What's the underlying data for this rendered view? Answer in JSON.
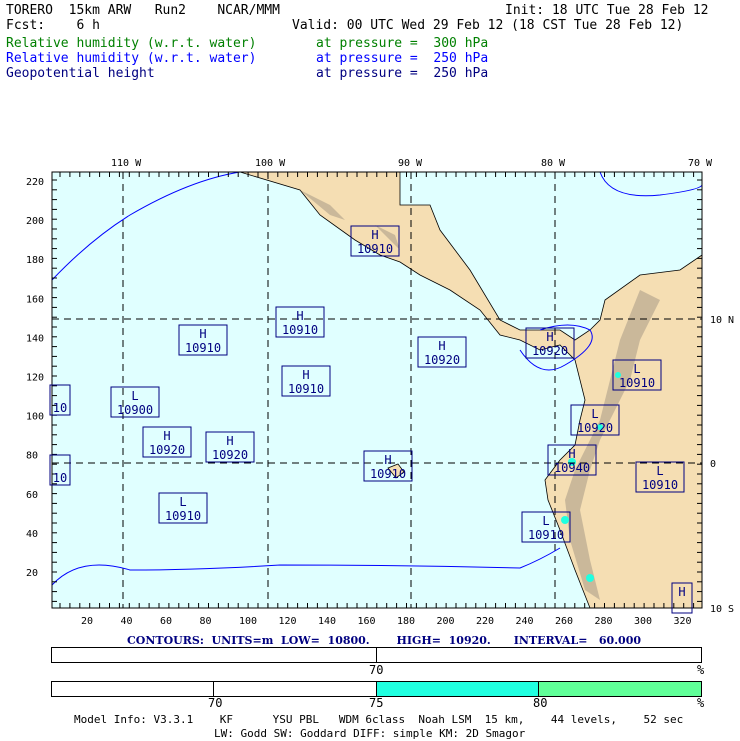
{
  "header": {
    "title": "TORERO  15km ARW   Run2    NCAR/MMM",
    "init": "Init: 18 UTC Tue 28 Feb 12",
    "fcst": "Fcst:    6 h",
    "valid": "Valid: 00 UTC Wed 29 Feb 12 (18 CST Tue 28 Feb 12)",
    "fields": [
      {
        "name": "Relative humidity (w.r.t. water)",
        "level": "at pressure =  300 hPa",
        "color": "#008000"
      },
      {
        "name": "Relative humidity (w.r.t. water)",
        "level": "at pressure =  250 hPa",
        "color": "#0000ff"
      },
      {
        "name": "Geopotential height",
        "level": "at pressure =  250 hPa",
        "color": "#000080"
      }
    ]
  },
  "map": {
    "lon_labels": [
      "110 W",
      "100 W",
      "90 W",
      "80 W",
      "70 W"
    ],
    "lat_labels": [
      "10 N",
      "0",
      "10 S"
    ],
    "y_ticks": [
      "220",
      "200",
      "180",
      "160",
      "140",
      "120",
      "100",
      "80",
      "60",
      "40",
      "20"
    ],
    "x_ticks": [
      "20",
      "40",
      "60",
      "80",
      "100",
      "120",
      "140",
      "160",
      "180",
      "200",
      "220",
      "240",
      "260",
      "280",
      "300",
      "320"
    ],
    "colors": {
      "ocean": "#e0ffff",
      "land": "#f5deb3",
      "contour": "#000080",
      "rh_high": "#20ffe0"
    },
    "centers": [
      {
        "type": "H",
        "value": "10910"
      },
      {
        "type": "H",
        "value": "10910"
      },
      {
        "type": "H",
        "value": "10910"
      },
      {
        "type": "H",
        "value": "10920"
      },
      {
        "type": "H",
        "value": "10920"
      },
      {
        "type": "H",
        "value": "10910"
      },
      {
        "type": "L",
        "value": "10900"
      },
      {
        "type": "",
        "value": "10"
      },
      {
        "type": "H",
        "value": "10920"
      },
      {
        "type": "H",
        "value": "10920"
      },
      {
        "type": "",
        "value": "10"
      },
      {
        "type": "H",
        "value": "10910"
      },
      {
        "type": "L",
        "value": "10910"
      },
      {
        "type": "L",
        "value": "10910"
      },
      {
        "type": "L",
        "value": "10920"
      },
      {
        "type": "H",
        "value": "10940"
      },
      {
        "type": "L",
        "value": "10910"
      },
      {
        "type": "L",
        "value": "10910"
      },
      {
        "type": "H",
        "value": ""
      }
    ]
  },
  "contours": "CONTOURS:  UNITS=m  LOW=  10800.       HIGH=  10920.      INTERVAL=   60.000",
  "legend1": {
    "labels": [
      "70",
      "%"
    ]
  },
  "legend2": {
    "labels": [
      "70",
      "75",
      "80",
      "%"
    ],
    "colors": [
      "#ffffff",
      "#ffffff",
      "#20ffe0",
      "#60ff98"
    ]
  },
  "footer": {
    "line1": "Model Info: V3.3.1    KF      YSU PBL   WDM 6class  Noah LSM  15 km,    44 levels,    52 sec",
    "line2": "LW: Godd SW: Goddard DIFF: simple KM: 2D Smagor"
  }
}
